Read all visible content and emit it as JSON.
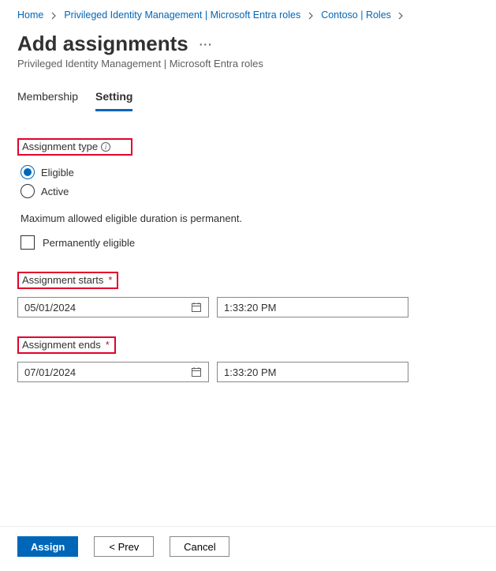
{
  "breadcrumb": {
    "items": [
      "Home",
      "Privileged Identity Management | Microsoft Entra roles",
      "Contoso | Roles"
    ]
  },
  "header": {
    "title": "Add assignments",
    "subtitle": "Privileged Identity Management | Microsoft Entra roles"
  },
  "tabs": {
    "items": [
      "Membership",
      "Setting"
    ],
    "active": "Setting"
  },
  "assignment_type": {
    "label": "Assignment type",
    "options": [
      "Eligible",
      "Active"
    ],
    "selected": "Eligible"
  },
  "max_note": "Maximum allowed eligible duration is permanent.",
  "perm_checkbox": {
    "label": "Permanently eligible",
    "checked": false
  },
  "starts": {
    "label": "Assignment starts",
    "date": "05/01/2024",
    "time": "1:33:20 PM"
  },
  "ends": {
    "label": "Assignment ends",
    "date": "07/01/2024",
    "time": "1:33:20 PM"
  },
  "footer": {
    "assign": "Assign",
    "prev": "<  Prev",
    "cancel": "Cancel"
  }
}
